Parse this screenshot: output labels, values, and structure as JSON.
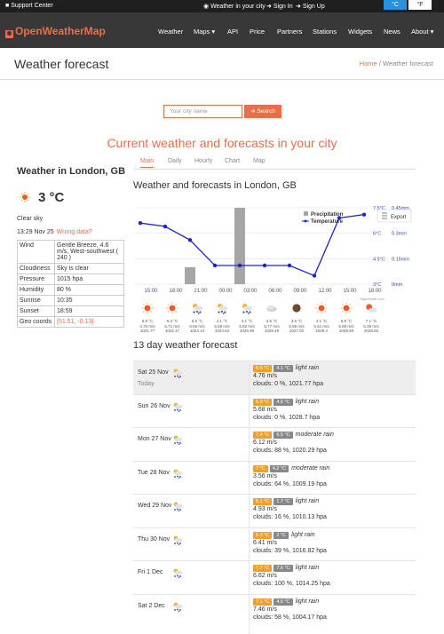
{
  "topbar": {
    "support": "Support Center",
    "tl": "Weather in your city",
    "signin": "Sign In",
    "signup": "Sign Up",
    "c": "°C",
    "f": "°F"
  },
  "nav": {
    "logo": "OpenWeatherMap",
    "items": [
      "Weather",
      "Maps ▾",
      "API",
      "Price",
      "Partners",
      "Stations",
      "Widgets",
      "News",
      "About ▾"
    ]
  },
  "header": {
    "title": "Weather forecast",
    "bc_home": "Home",
    "bc_sep": "/",
    "bc_cur": "Weather forecast"
  },
  "search": {
    "placeholder": "Your city name",
    "button": "Search"
  },
  "main": {
    "heading": "Current weather and forecasts in your city",
    "tabs": [
      "Main",
      "Daily",
      "Hourly",
      "Chart",
      "Map"
    ]
  },
  "current": {
    "title": "Weather in London, GB",
    "temp": "3 °C",
    "cond": "Clear sky",
    "time": "13:29 Nov 25",
    "wrong": "Wrong data?",
    "rows": [
      {
        "k": "Wind",
        "v": "Gentle Breeze, 4.6 m/s, West-southwest ( 240 )"
      },
      {
        "k": "Cloudiness",
        "v": "Sky is clear"
      },
      {
        "k": "Pressure",
        "v": "1015 hpa"
      },
      {
        "k": "Humidity",
        "v": "80 %"
      },
      {
        "k": "Sunrise",
        "v": "10:35"
      },
      {
        "k": "Sunset",
        "v": "18:59"
      },
      {
        "k": "Geo coords",
        "v": "[51.51, -0.13]"
      }
    ]
  },
  "forecast_title": "Weather and forecasts in London, GB",
  "chart_data": {
    "type": "line",
    "x": [
      "15:00",
      "18:00",
      "21:00",
      "00:00",
      "03:00",
      "06:00",
      "09:00",
      "12:00",
      "15:00",
      "18:00"
    ],
    "series": [
      {
        "name": "Temperature",
        "values": [
          6.6,
          6.4,
          5.6,
          4.1,
          4.1,
          4.1,
          4.1,
          3.5,
          6.9,
          7.1
        ]
      },
      {
        "name": "Precipitation",
        "values": [
          0,
          0,
          0.1,
          0,
          0.45,
          0,
          0,
          0,
          0,
          0
        ]
      }
    ],
    "y_left_ticks": [
      "7.5°C",
      "6°C",
      "4.5°C",
      "3°C"
    ],
    "y_right_ticks": [
      "0.45mm",
      "0.3mm",
      "0.15mm",
      "0mm"
    ],
    "y_left_range": [
      3,
      7.5
    ],
    "y_right_range": [
      0,
      0.45
    ],
    "legend": [
      "Precipitation",
      "Temperature"
    ],
    "export": "Export",
    "credit": "Highcharts.com"
  },
  "hourly": [
    {
      "t": "6.6 °C",
      "w": "4.76 m/s",
      "p": "1021.77",
      "i": "sun"
    },
    {
      "t": "6.4 °C",
      "w": "5.71 m/s",
      "p": "1022.17",
      "i": "sun"
    },
    {
      "t": "5.6 °C",
      "w": "5.56 m/s",
      "p": "1024.14",
      "i": "rain"
    },
    {
      "t": "4.1 °C",
      "w": "5.58 m/s",
      "p": "1024.54",
      "i": "rain"
    },
    {
      "t": "4.1 °C",
      "w": "5.82 m/s",
      "p": "1025.99",
      "i": "rain"
    },
    {
      "t": "3.5 °C",
      "w": "5.77 m/s",
      "p": "1026.49",
      "i": "cloud"
    },
    {
      "t": "3.5 °C",
      "w": "5.56 m/s",
      "p": "1027.02",
      "i": "moon"
    },
    {
      "t": "4.1 °C",
      "w": "5.61 m/s",
      "p": "1028.4",
      "i": "sun"
    },
    {
      "t": "6.9 °C",
      "w": "5.88 m/s",
      "p": "1028.59",
      "i": "sun"
    },
    {
      "t": "7.1 °C",
      "w": "5.35 m/s",
      "p": "1028.82",
      "i": "partly"
    }
  ],
  "days_title": "13 day weather forecast",
  "days": [
    {
      "d": "Sat 25 Nov",
      "d2": "Today",
      "max": "6.6 °C",
      "min": "4.1 °C",
      "desc": "light rain",
      "wind": "4.76 m/s",
      "clouds": "clouds: 0 %, 1021.77 hpa"
    },
    {
      "d": "Sun 26 Nov",
      "d2": "",
      "max": "6.9 °C",
      "min": "4.6 °C",
      "desc": "light rain",
      "wind": "5.68 m/s",
      "clouds": "clouds: 0 %, 1028.7 hpa"
    },
    {
      "d": "Mon 27 Nov",
      "d2": "",
      "max": "7.4 °C",
      "min": "6.5 °C",
      "desc": "moderate rain",
      "wind": "6.12 m/s",
      "clouds": "clouds: 88 %, 1020.29 hpa"
    },
    {
      "d": "Tue 28 Nov",
      "d2": "",
      "max": "7 °C",
      "min": "4.2 °C",
      "desc": "moderate rain",
      "wind": "3.56 m/s",
      "clouds": "clouds: 64 %, 1009.19 hpa"
    },
    {
      "d": "Wed 29 Nov",
      "d2": "",
      "max": "5.1 °C",
      "min": "1.7 °C",
      "desc": "light rain",
      "wind": "4.93 m/s",
      "clouds": "clouds: 16 %, 1010.13 hpa"
    },
    {
      "d": "Thu 30 Nov",
      "d2": "",
      "max": "5.3 °C",
      "min": "2 °C",
      "desc": "light rain",
      "wind": "6.41 m/s",
      "clouds": "clouds: 39 %, 1016.82 hpa"
    },
    {
      "d": "Fri 1 Dec",
      "d2": "",
      "max": "7.7 °C",
      "min": "7.6 °C",
      "desc": "light rain",
      "wind": "6.62 m/s",
      "clouds": "clouds: 100 %, 1014.25 hpa"
    },
    {
      "d": "Sat 2 Dec",
      "d2": "",
      "max": "7.1 °C",
      "min": "4.6 °C",
      "desc": "light rain",
      "wind": "7.46 m/s",
      "clouds": "clouds: 58 %, 1004.17 hpa"
    }
  ],
  "colors": {
    "accent": "#eb6e4b",
    "nav": "#383838",
    "line": "#1d23d6",
    "bar": "#a6a6a6"
  }
}
